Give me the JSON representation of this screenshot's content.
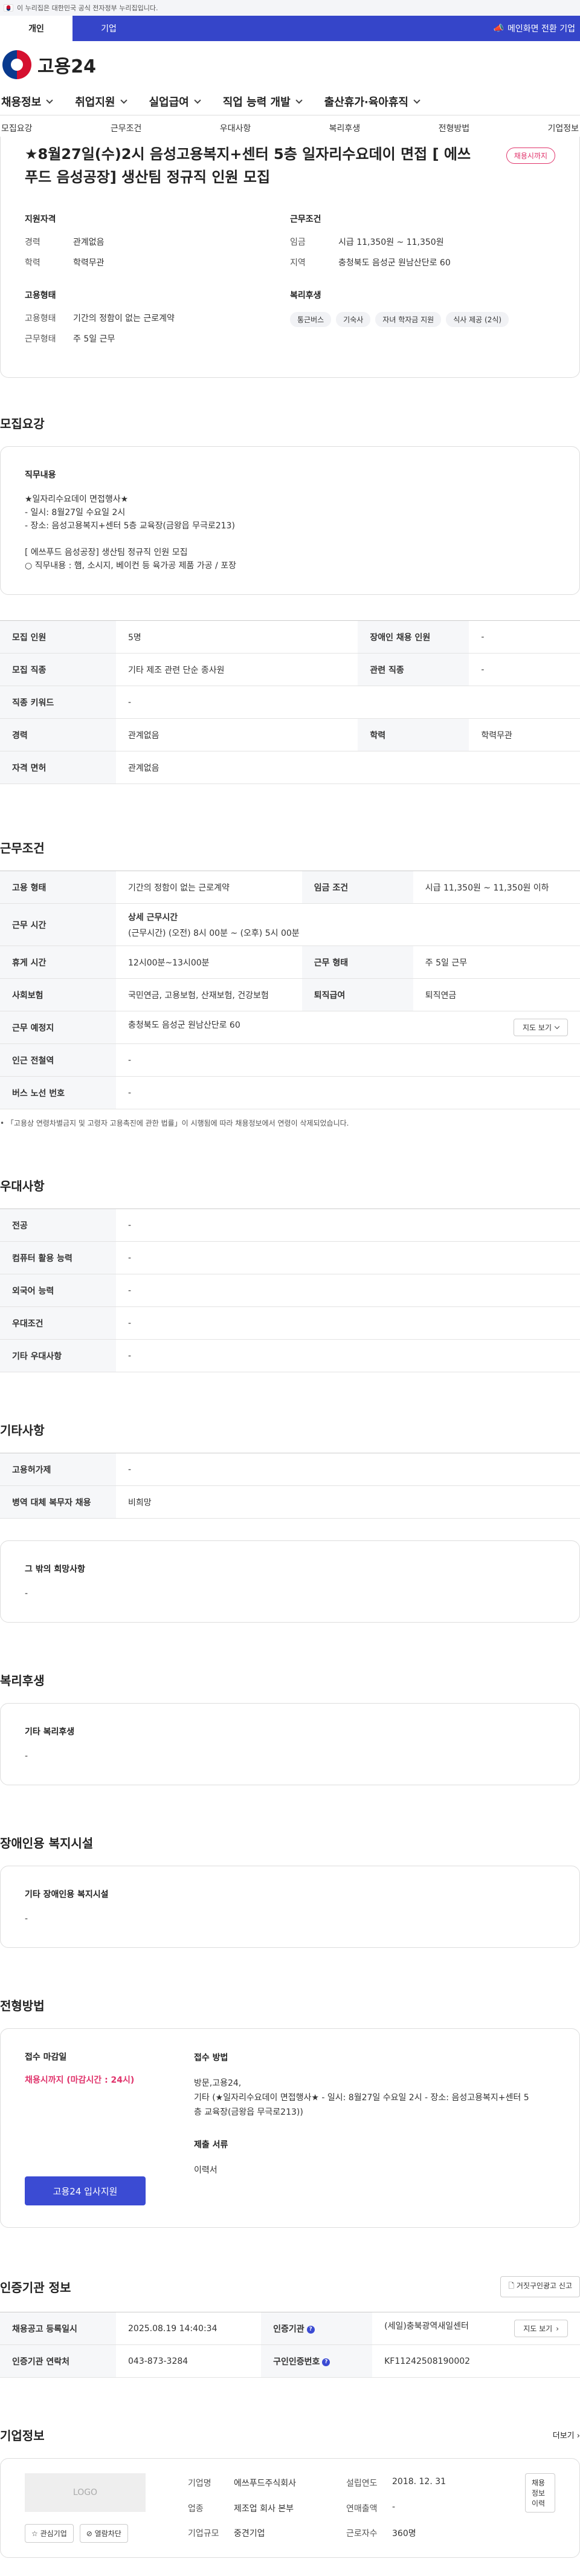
{
  "gov_banner": "이 누리집은 대한민국 공식 전자정부 누리집입니다.",
  "mode_tabs": [
    "개인",
    "기업"
  ],
  "mode_link": "메인화면 전환 기업",
  "logo_text": "고용24",
  "gnb": [
    "채용정보",
    "취업지원",
    "실업급여",
    "직업 능력 개발",
    "출산휴가·육아휴직"
  ],
  "anchors": [
    "모집요강",
    "근무조건",
    "우대사항",
    "복리후생",
    "전형방법",
    "기업정보"
  ],
  "job": {
    "title": "★8월27일(수)2시 음성고용복지+센터 5층 일자리수요데이 면접 [ 에쓰푸드 음성공장] 생산팀 정규직 인원 모집",
    "status": "채용시까지",
    "qual_h": "지원자격",
    "qual": [
      [
        "경력",
        "관계없음"
      ],
      [
        "학력",
        "학력무관"
      ]
    ],
    "cond_h": "근무조건",
    "cond": [
      [
        "임금",
        "시급 11,350원 ~ 11,350원"
      ],
      [
        "지역",
        "충청북도 음성군 원남산단로 60"
      ]
    ],
    "emp_h": "고용형태",
    "emp": [
      [
        "고용형태",
        "기간의 정함이 없는 근로계약"
      ],
      [
        "근무형태",
        "주 5일 근무"
      ]
    ],
    "welfare_h": "복리후생",
    "welfare_tags": [
      "통근버스",
      "기숙사",
      "자녀 학자금 지원",
      "식사 제공 (2식)"
    ]
  },
  "recruit": {
    "title": "모집요강",
    "duty_h": "직무내용",
    "duty_lines": [
      "★일자리수요데이 면접행사★",
      "- 일시: 8월27일 수요일 2시",
      "- 장소: 음성고용복지+센터 5층 교육장(금왕읍 무극로213)",
      "",
      "[ 에쓰푸드 음성공장] 생산팀 정규직 인원 모집",
      "○ 직무내용 : 햄, 소시지, 베이컨 등 육가공 제품 가공 / 포장"
    ],
    "rows": [
      [
        "모집 인원",
        "5명",
        "장애인 채용 인원",
        "-"
      ],
      [
        "모집 직종",
        "기타 제조 관련 단순 종사원",
        "관련 직종",
        "-"
      ],
      [
        "직종 키워드",
        "-"
      ],
      [
        "경력",
        "관계없음",
        "학력",
        "학력무관"
      ],
      [
        "자격 면허",
        "관계없음"
      ]
    ]
  },
  "work": {
    "title": "근무조건",
    "emp_k": "고용 형태",
    "emp_v": "기간의 정함이 없는 근로계약",
    "wage_k": "임금 조건",
    "wage_v": "시급 11,350원 ~ 11,350원 이하",
    "time_k": "근무 시간",
    "time_h": "상세 근무시간",
    "time_v": "(근무시간) (오전) 8시 00분 ~ (오후) 5시 00분",
    "rest_k": "휴게 시간",
    "rest_v": "12시00분~13시00분",
    "shift_k": "근무 형태",
    "shift_v": "주 5일 근무",
    "ins_k": "사회보험",
    "ins_v": "국민연금, 고용보험, 산재보험, 건강보험",
    "ret_k": "퇴직급여",
    "ret_v": "퇴직연금",
    "place_k": "근무 예정지",
    "place_v": "충청북도 음성군 원남산단로 60",
    "map_btn": "지도 보기",
    "subway_k": "인근 전철역",
    "subway_v": "-",
    "bus_k": "버스 노선 번호",
    "bus_v": "-",
    "note": "「고용상 연령차별금지 및 고령자 고용촉진에 관한 법률」이 시행됨에 따라 채용정보에서 연령이 삭제되었습니다."
  },
  "pref": {
    "title": "우대사항",
    "rows": [
      [
        "전공",
        "-"
      ],
      [
        "컴퓨터 활용 능력",
        "-"
      ],
      [
        "외국어 능력",
        "-"
      ],
      [
        "우대조건",
        "-"
      ],
      [
        "기타 우대사항",
        "-"
      ]
    ]
  },
  "etc": {
    "title": "기타사항",
    "rows": [
      [
        "고용허가제",
        "-"
      ],
      [
        "병역 대체 복무자 채용",
        "비희망"
      ]
    ],
    "hope_h": "그 밖의 희망사항",
    "hope_v": "-"
  },
  "welfare": {
    "title": "복리후생",
    "h": "기타 복리후생",
    "v": "-"
  },
  "disabled": {
    "title": "장애인용 복지시설",
    "h": "기타 장애인용 복지시설",
    "v": "-"
  },
  "apply": {
    "title": "전형방법",
    "deadline_h": "접수 마감일",
    "deadline_v": "채용시까지 (마감시간 : 24시)",
    "method_h": "접수 방법",
    "method_v": "방문,고용24,",
    "method_etc": "기타 (★일자리수요데이 면접행사★ - 일시: 8월27일 수요일 2시 - 장소: 음성고용복지+센터 5층 교육장(금왕읍 무극로213))",
    "docs_h": "제출 서류",
    "docs_v": "이력서",
    "apply_btn": "고용24 입사지원"
  },
  "cert": {
    "title": "인증기관 정보",
    "report_btn": "거짓구인광고 신고",
    "reg_k": "채용공고 등록일시",
    "reg_v": "2025.08.19 14:40:34",
    "org_k": "인증기관",
    "org_v": "(세일)충북광역새일센터",
    "detail_btn": "지도 보기",
    "tel_k": "인증기관 연락처",
    "tel_v": "043-873-3284",
    "no_k": "구인인증번호",
    "no_v": "KF11242508190002"
  },
  "company": {
    "title": "기업정보",
    "more": "더보기",
    "logo": "LOGO",
    "btn_interest": "관심기업",
    "btn_block": "열람차단",
    "fields": [
      [
        "기업명",
        "에쓰푸드주식회사",
        "설립연도",
        "2018. 12. 31"
      ],
      [
        "업종",
        "제조업 회사 본부",
        "연매출액",
        "-"
      ],
      [
        "기업규모",
        "중견기업",
        "근로자수",
        "360명"
      ]
    ],
    "jobs_btn": "채용정보 이력"
  }
}
